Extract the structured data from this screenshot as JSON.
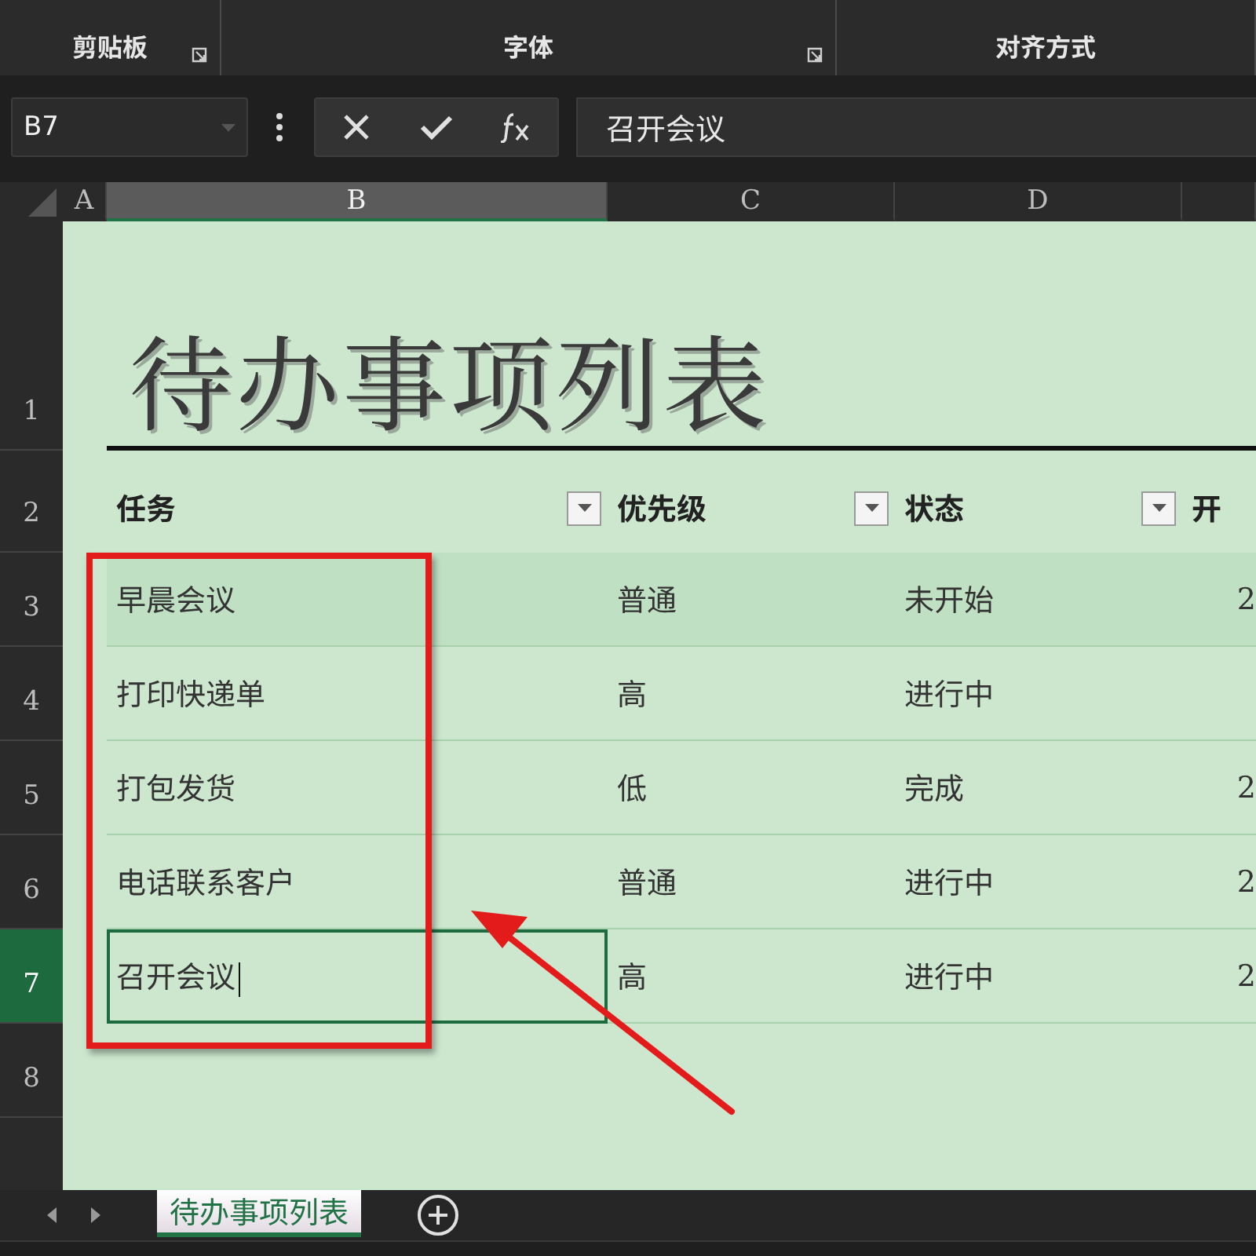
{
  "ribbon": {
    "groups": [
      {
        "label": "剪贴板",
        "launcher": true
      },
      {
        "label": "字体",
        "launcher": true
      },
      {
        "label": "对齐方式",
        "launcher": false
      }
    ]
  },
  "formula_bar": {
    "name_box": "B7",
    "formula": "召开会议"
  },
  "columns": [
    {
      "label": "A",
      "selected": false
    },
    {
      "label": "B",
      "selected": true
    },
    {
      "label": "C",
      "selected": false
    },
    {
      "label": "D",
      "selected": false
    }
  ],
  "row_headers": [
    {
      "label": "1",
      "selected": false
    },
    {
      "label": "2",
      "selected": false
    },
    {
      "label": "3",
      "selected": false
    },
    {
      "label": "4",
      "selected": false
    },
    {
      "label": "5",
      "selected": false
    },
    {
      "label": "6",
      "selected": false
    },
    {
      "label": "7",
      "selected": true
    },
    {
      "label": "8",
      "selected": false
    }
  ],
  "sheet": {
    "title": "待办事项列表",
    "headers": [
      {
        "label": "任务",
        "filter": true
      },
      {
        "label": "优先级",
        "filter": true
      },
      {
        "label": "状态",
        "filter": true
      },
      {
        "label": "开",
        "filter": false
      }
    ],
    "rows": [
      {
        "task": "早晨会议",
        "priority": "普通",
        "status": "未开始",
        "column_4": "2",
        "highlighted": true,
        "active": false
      },
      {
        "task": "打印快递单",
        "priority": "高",
        "status": "进行中",
        "highlighted": false,
        "active": false
      },
      {
        "task": "打包发货",
        "priority": "低",
        "status": "完成",
        "column_4": "2",
        "highlighted": false,
        "active": false
      },
      {
        "task": "电话联系客户",
        "priority": "普通",
        "status": "进行中",
        "column_4": "2",
        "highlighted": false,
        "active": false
      },
      {
        "task": "召开会议",
        "priority": "高",
        "status": "进行中",
        "column_4": "2",
        "highlighted": false,
        "active": true
      }
    ]
  },
  "sheet_tabs": [
    {
      "label": "待办事项列表",
      "selected": true
    }
  ]
}
